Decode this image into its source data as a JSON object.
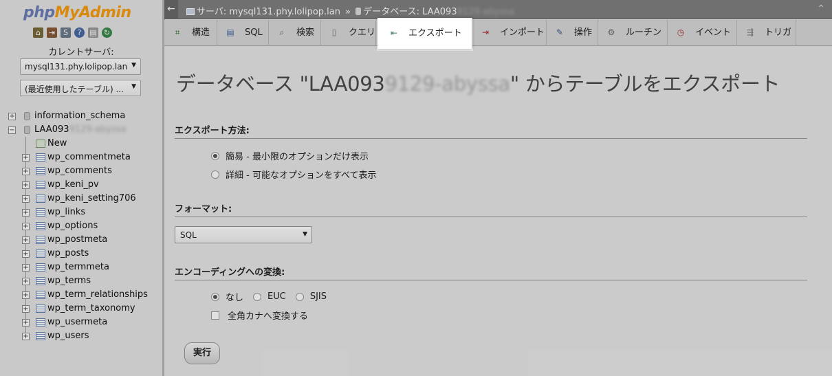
{
  "logo": {
    "php": "php",
    "my": "MyAdmin"
  },
  "left": {
    "icons": [
      "home-icon",
      "exit-icon",
      "sql-query-icon",
      "help-icon",
      "docs-icon",
      "reload-icon"
    ],
    "server_label": "カレントサーバ:",
    "server_select": "mysql131.phy.lolipop.lan",
    "recent_select": "(最近使用したテーブル) ...",
    "databases": [
      {
        "name": "information_schema",
        "expanded": false
      },
      {
        "name": "LAA093",
        "name_blurred": "9129-abyssa",
        "expanded": true
      }
    ],
    "new_label": "New",
    "tables": [
      "wp_commentmeta",
      "wp_comments",
      "wp_keni_pv",
      "wp_keni_setting706",
      "wp_links",
      "wp_options",
      "wp_postmeta",
      "wp_posts",
      "wp_termmeta",
      "wp_terms",
      "wp_term_relationships",
      "wp_term_taxonomy",
      "wp_usermeta",
      "wp_users"
    ]
  },
  "breadcrumb": {
    "back": "←",
    "server": "サーバ: mysql131.phy.lolipop.lan",
    "separator": "»",
    "database": "データベース: LAA093",
    "database_blurred": "9129-abyssa",
    "close": "⌃"
  },
  "tabs": [
    {
      "label": "構造",
      "icon": "structure-icon"
    },
    {
      "label": "SQL",
      "icon": "sql-icon"
    },
    {
      "label": "検索",
      "icon": "search-icon"
    },
    {
      "label": "クエリ",
      "icon": "query-icon"
    },
    {
      "label": "エクスポート",
      "icon": "export-icon",
      "active": true
    },
    {
      "label": "インポート",
      "icon": "import-icon"
    },
    {
      "label": "操作",
      "icon": "operations-icon"
    },
    {
      "label": "ルーチン",
      "icon": "routines-icon"
    },
    {
      "label": "イベント",
      "icon": "events-icon"
    },
    {
      "label": "トリガ",
      "icon": "triggers-icon"
    }
  ],
  "main": {
    "title_prefix": "データベース \"LAA093",
    "title_blurred": "9129-abyssa",
    "title_suffix": "\" からテーブルをエクスポート",
    "export_method_heading": "エクスポート方法:",
    "export_methods": [
      {
        "label": "簡易 - 最小限のオプションだけ表示",
        "checked": true
      },
      {
        "label": "詳細 - 可能なオプションをすべて表示",
        "checked": false
      }
    ],
    "format_heading": "フォーマット:",
    "format_value": "SQL",
    "encoding_heading": "エンコーディングへの変換:",
    "encodings": [
      {
        "label": "なし",
        "checked": true
      },
      {
        "label": "EUC",
        "checked": false
      },
      {
        "label": "SJIS",
        "checked": false
      }
    ],
    "kana_label": "全角カナへ変換する",
    "go_button": "実行"
  },
  "colors": {
    "accent_orange": "#f89c0e",
    "logo_blue": "#6c7eb7",
    "topbar_gray": "#808080"
  }
}
